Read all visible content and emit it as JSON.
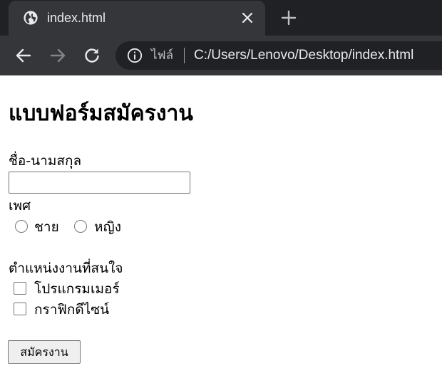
{
  "browser": {
    "tab": {
      "title": "index.html",
      "favicon": "globe-icon",
      "close_icon": "close-icon"
    },
    "new_tab_icon": "plus-icon",
    "nav": {
      "back_icon": "arrow-left-icon",
      "forward_icon": "arrow-right-icon",
      "reload_icon": "reload-icon"
    },
    "omnibox": {
      "info_icon": "info-icon",
      "scheme_label": "ไฟล์",
      "url": "C:/Users/Lenovo/Desktop/index.html"
    },
    "colors": {
      "tabstrip": "#202124",
      "toolbar": "#35363a",
      "text": "#e8eaed"
    }
  },
  "form": {
    "title": "แบบฟอร์มสมัครงาน",
    "name_label": "ชื่อ-นามสกุล",
    "name_value": "",
    "gender_label": "เพศ",
    "gender_options": [
      "ชาย",
      "หญิง"
    ],
    "gender_selected": null,
    "position_label": "ตำแหน่งงานที่สนใจ",
    "position_options": [
      "โปรแกรมเมอร์",
      "กราฟิกดีไซน์"
    ],
    "positions_checked": [
      false,
      false
    ],
    "submit_label": "สมัครงาน"
  }
}
